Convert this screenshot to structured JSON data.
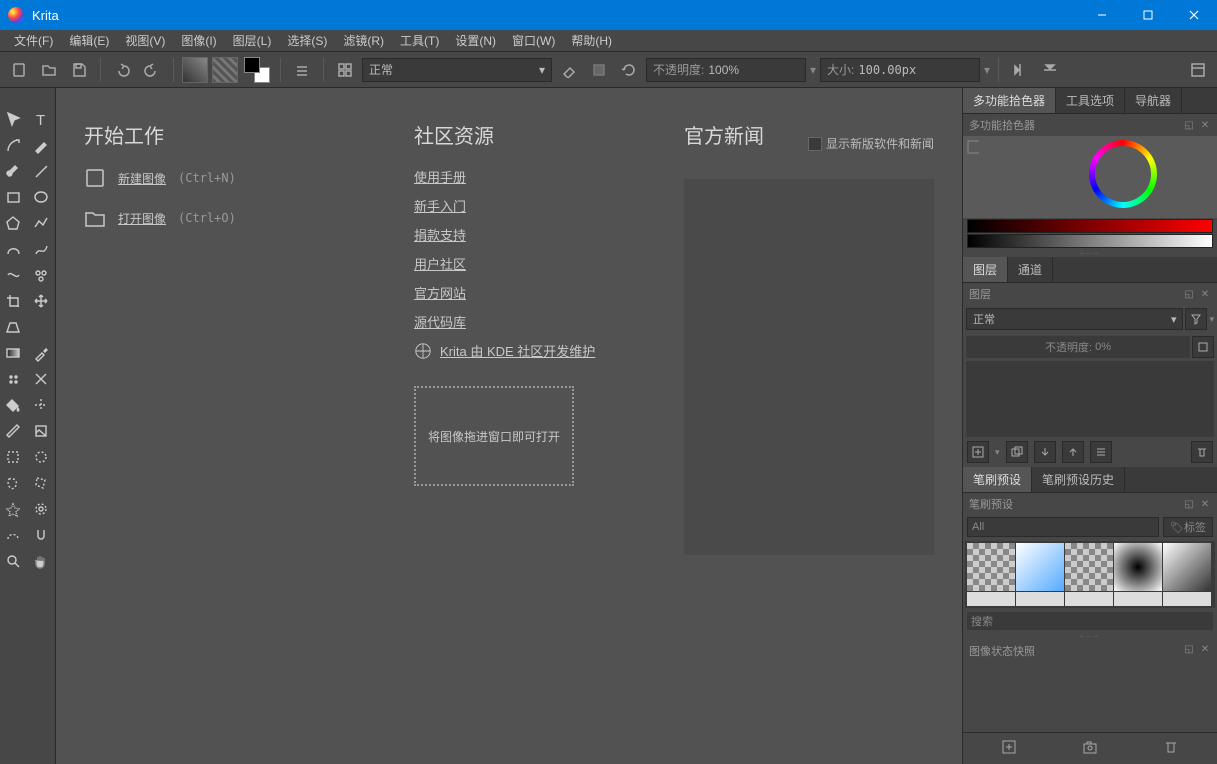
{
  "app": {
    "title": "Krita"
  },
  "menu": [
    "文件(F)",
    "编辑(E)",
    "视图(V)",
    "图像(I)",
    "图层(L)",
    "选择(S)",
    "滤镜(R)",
    "工具(T)",
    "设置(N)",
    "窗口(W)",
    "帮助(H)"
  ],
  "toolbar": {
    "blend_mode": "正常",
    "opacity_label": "不透明度:",
    "opacity_value": "100%",
    "size_label": "大小:",
    "size_value": "100.00px"
  },
  "start": {
    "heading": "开始工作",
    "new_image": "新建图像",
    "new_shortcut": "(Ctrl+N)",
    "open_image": "打开图像",
    "open_shortcut": "(Ctrl+O)"
  },
  "community": {
    "heading": "社区资源",
    "links": [
      "使用手册",
      "新手入门",
      "捐款支持",
      "用户社区",
      "官方网站",
      "源代码库"
    ],
    "kde": "Krita 由 KDE 社区开发维护",
    "dropzone": "将图像拖进窗口即可打开"
  },
  "news": {
    "heading": "官方新闻",
    "checkbox": "显示新版软件和新闻"
  },
  "dockers": {
    "color_tabs": [
      "多功能拾色器",
      "工具选项",
      "导航器"
    ],
    "color_title": "多功能拾色器",
    "layer_tabs": [
      "图层",
      "通道"
    ],
    "layer_title": "图层",
    "layer_blend": "正常",
    "layer_opacity_label": "不透明度:",
    "layer_opacity_value": "0%",
    "brush_tabs": [
      "笔刷预设",
      "笔刷预设历史"
    ],
    "brush_title": "笔刷预设",
    "brush_filter": "All",
    "brush_tag": "标签",
    "brush_search": "搜索",
    "snapshot_title": "图像状态快照"
  }
}
